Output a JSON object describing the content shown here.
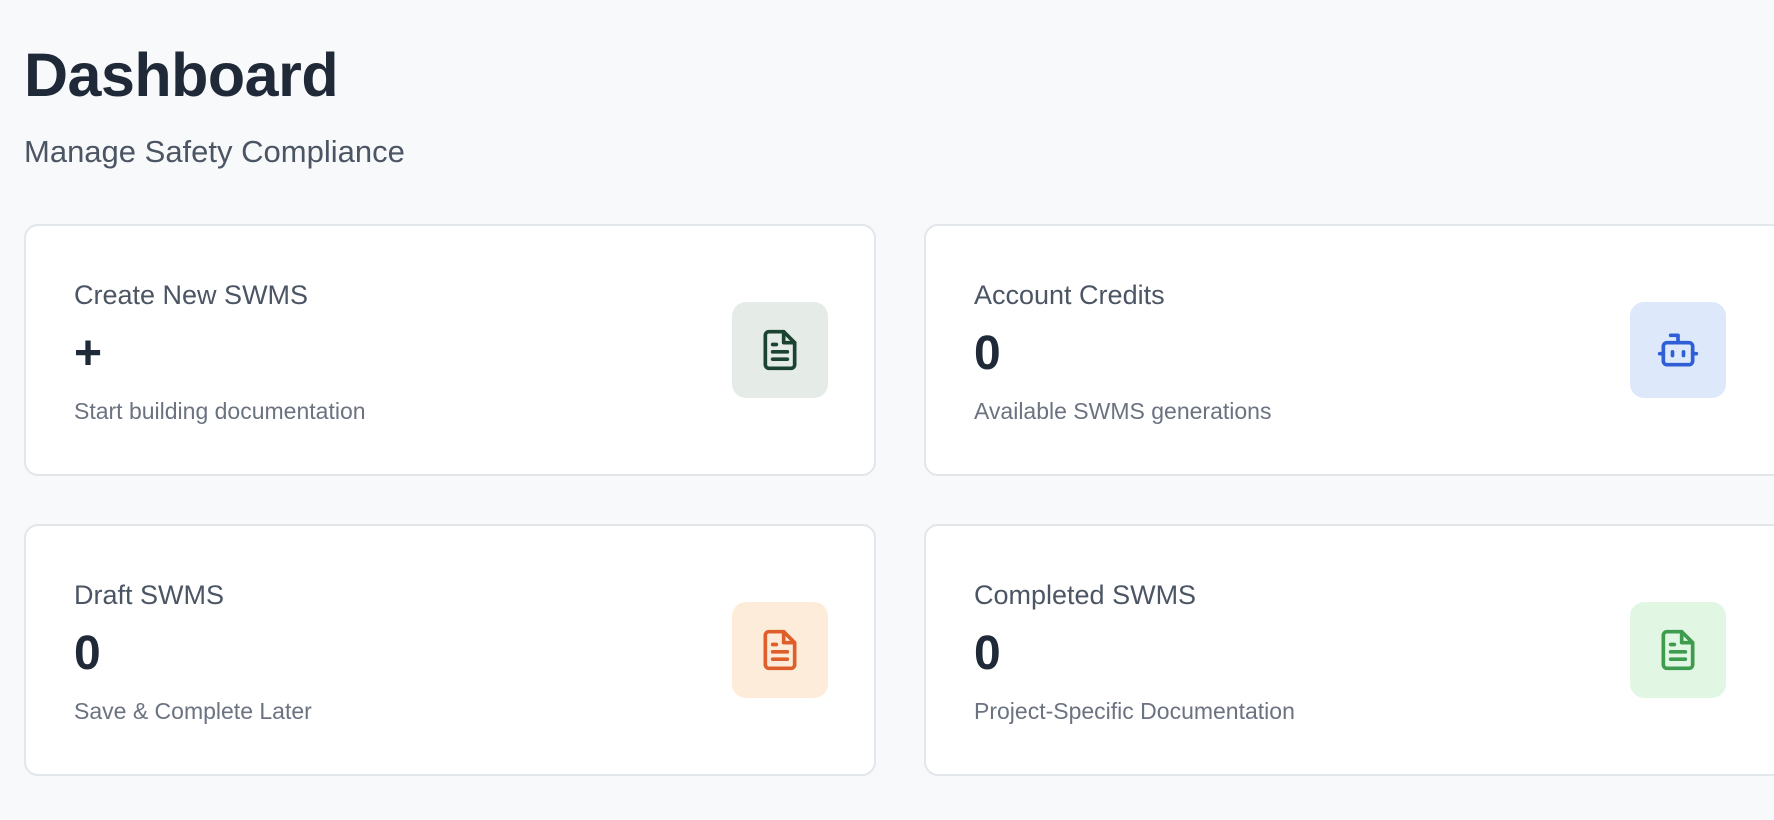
{
  "header": {
    "title": "Dashboard",
    "subtitle": "Manage Safety Compliance"
  },
  "cards": [
    {
      "label": "Create New SWMS",
      "value": "+",
      "description": "Start building documentation",
      "icon": "document-icon",
      "icon_color": "#1b4332",
      "icon_bg": "#e5ebe7"
    },
    {
      "label": "Account Credits",
      "value": "0",
      "description": "Available SWMS generations",
      "icon": "bot-icon",
      "icon_color": "#2f5fd6",
      "icon_bg": "#dde8fb"
    },
    {
      "label": "Draft SWMS",
      "value": "0",
      "description": "Save & Complete Later",
      "icon": "document-icon",
      "icon_color": "#df5f2a",
      "icon_bg": "#fdecd9"
    },
    {
      "label": "Completed SWMS",
      "value": "0",
      "description": "Project-Specific Documentation",
      "icon": "document-icon",
      "icon_color": "#3f9b4e",
      "icon_bg": "#e1f7e4"
    }
  ]
}
